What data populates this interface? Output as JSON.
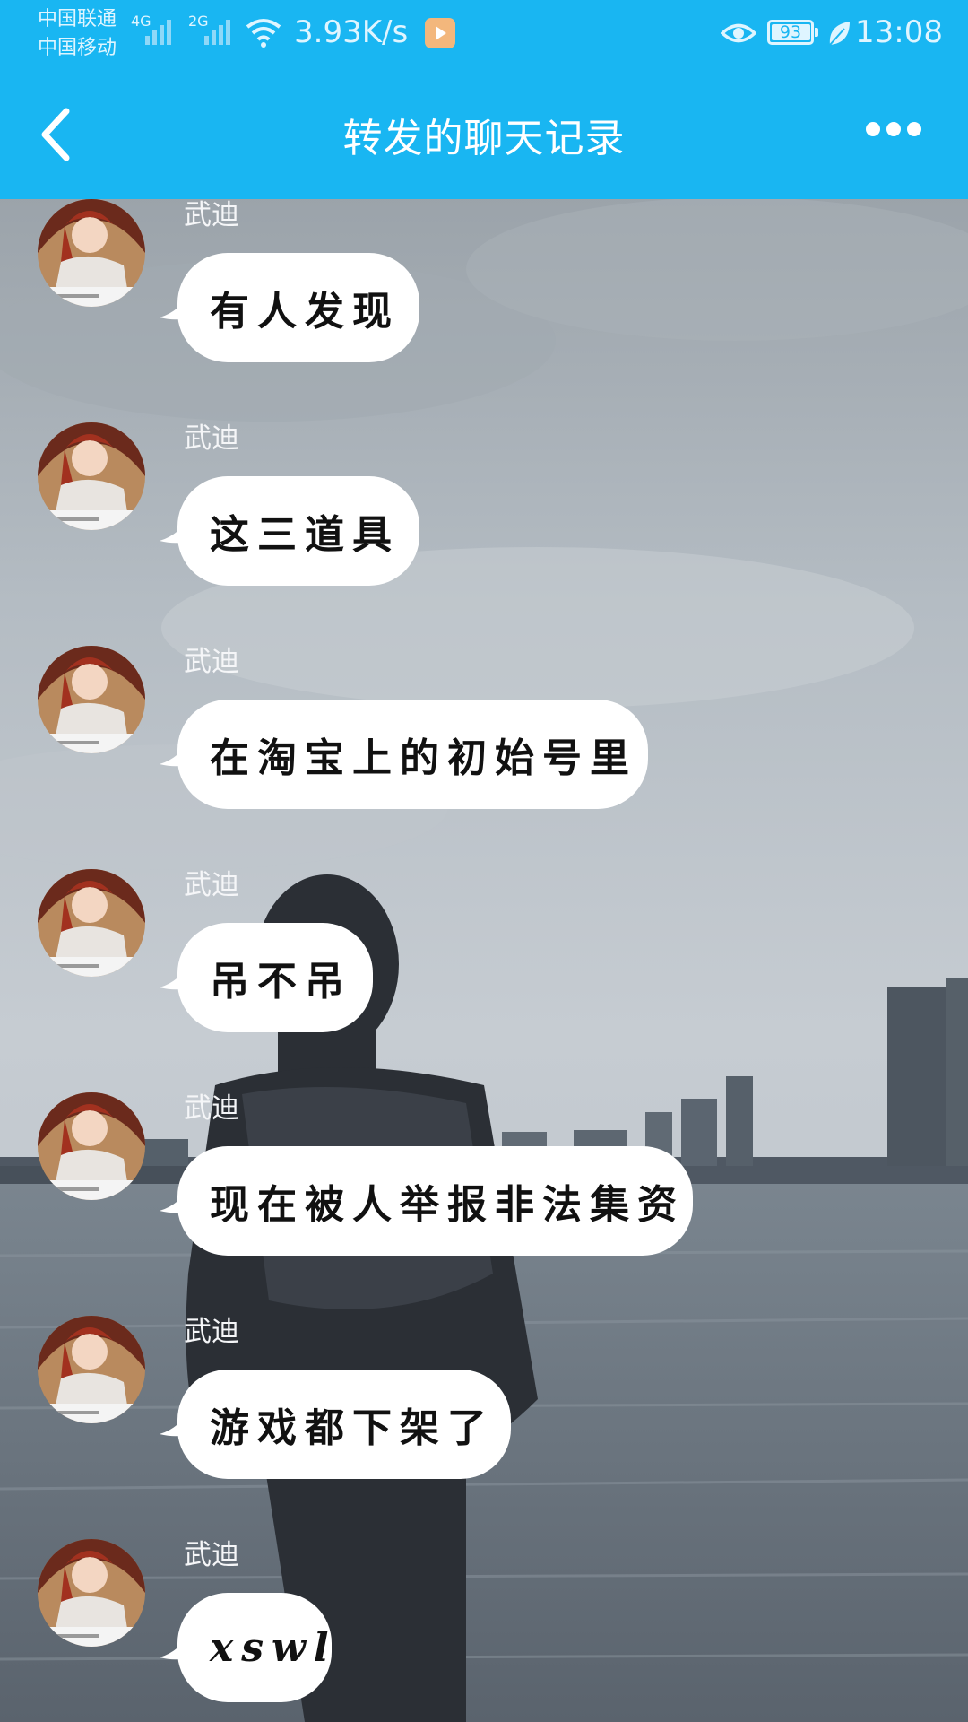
{
  "status_bar": {
    "carrier_1": "中国联通",
    "carrier_2": "中国移动",
    "network_1": "4G",
    "network_2": "2G",
    "net_speed": "3.93K/s",
    "battery": "93",
    "time": "13:08"
  },
  "nav": {
    "title": "转发的聊天记录",
    "back_icon": "chevron-left-icon",
    "more_icon": "more-dots-icon"
  },
  "messages": [
    {
      "sender": "武迪",
      "text": "有人发现"
    },
    {
      "sender": "武迪",
      "text": "这三道具"
    },
    {
      "sender": "武迪",
      "text": "在淘宝上的初始号里"
    },
    {
      "sender": "武迪",
      "text": "吊不吊"
    },
    {
      "sender": "武迪",
      "text": "现在被人举报非法集资"
    },
    {
      "sender": "武迪",
      "text": "游戏都下架了"
    },
    {
      "sender": "武迪",
      "text": "xswl"
    }
  ],
  "colors": {
    "header": "#19b6f2",
    "bubble": "#ffffff",
    "text": "#111111"
  }
}
